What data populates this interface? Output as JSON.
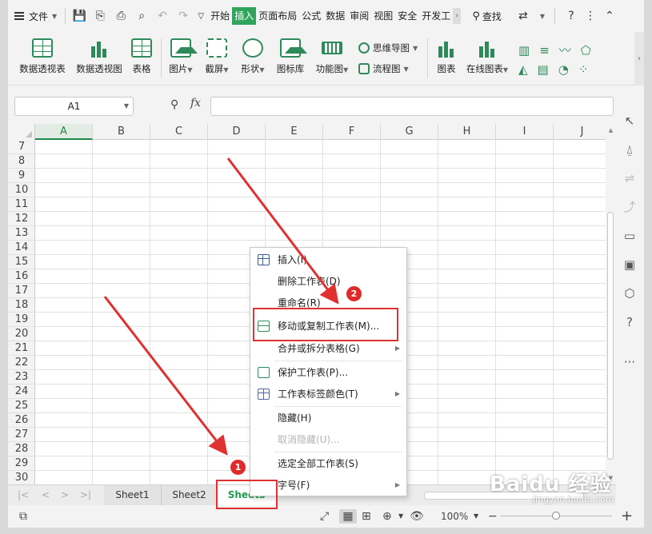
{
  "menubar": {
    "file_label": "文件",
    "tabs": [
      "开始",
      "插入",
      "页面布局",
      "公式",
      "数据",
      "审阅",
      "视图",
      "安全",
      "开发工"
    ],
    "active_tab": "插入",
    "search_label": "查找"
  },
  "ribbon": {
    "pivot_table": "数据透视表",
    "pivot_chart": "数据透视图",
    "table": "表格",
    "picture": "图片",
    "screenshot": "截屏",
    "shape": "形状",
    "icon_lib": "图标库",
    "func_chart": "功能图",
    "mindmap": "思维导图",
    "flowchart": "流程图",
    "chart": "图表",
    "online_chart": "在线图表"
  },
  "formula_bar": {
    "name_box": "A1",
    "fx": "fx",
    "formula": ""
  },
  "grid": {
    "columns": [
      "A",
      "B",
      "C",
      "D",
      "E",
      "F",
      "G",
      "H",
      "I",
      "J"
    ],
    "active_column": "A",
    "rows": [
      "7",
      "8",
      "9",
      "10",
      "11",
      "12",
      "13",
      "14",
      "15",
      "16",
      "17",
      "18",
      "19",
      "20",
      "21",
      "22",
      "23",
      "24",
      "25",
      "26",
      "27",
      "28",
      "29",
      "30"
    ]
  },
  "context_menu": {
    "items": [
      {
        "label": "插入(I)",
        "enabled": true,
        "icon": "table-icon"
      },
      {
        "label": "删除工作表(D)",
        "enabled": true
      },
      {
        "label": "重命名(R)",
        "enabled": true
      },
      {
        "label": "移动或复制工作表(M)...",
        "enabled": true,
        "icon": "move-copy-icon"
      },
      {
        "label": "合并或拆分表格(G)",
        "enabled": true,
        "submenu": true
      },
      {
        "label": "保护工作表(P)...",
        "enabled": true,
        "icon": "protect-icon"
      },
      {
        "label": "工作表标签颜色(T)",
        "enabled": true,
        "submenu": true,
        "icon": "tab-color-icon"
      },
      {
        "label": "隐藏(H)",
        "enabled": true
      },
      {
        "label": "取消隐藏(U)...",
        "enabled": false
      },
      {
        "label": "选定全部工作表(S)",
        "enabled": true
      },
      {
        "label": "字号(F)",
        "enabled": true,
        "submenu": true
      }
    ]
  },
  "sheets": {
    "tabs": [
      "Sheet1",
      "Sheet2",
      "Sheet3"
    ],
    "active": "Sheet3"
  },
  "status_bar": {
    "zoom": "100%"
  },
  "annotations": {
    "badge1": "1",
    "badge2": "2",
    "color": "#e03030"
  },
  "watermark": {
    "text": "Baidu 经验",
    "sub": "jingyan.baidu.com"
  }
}
